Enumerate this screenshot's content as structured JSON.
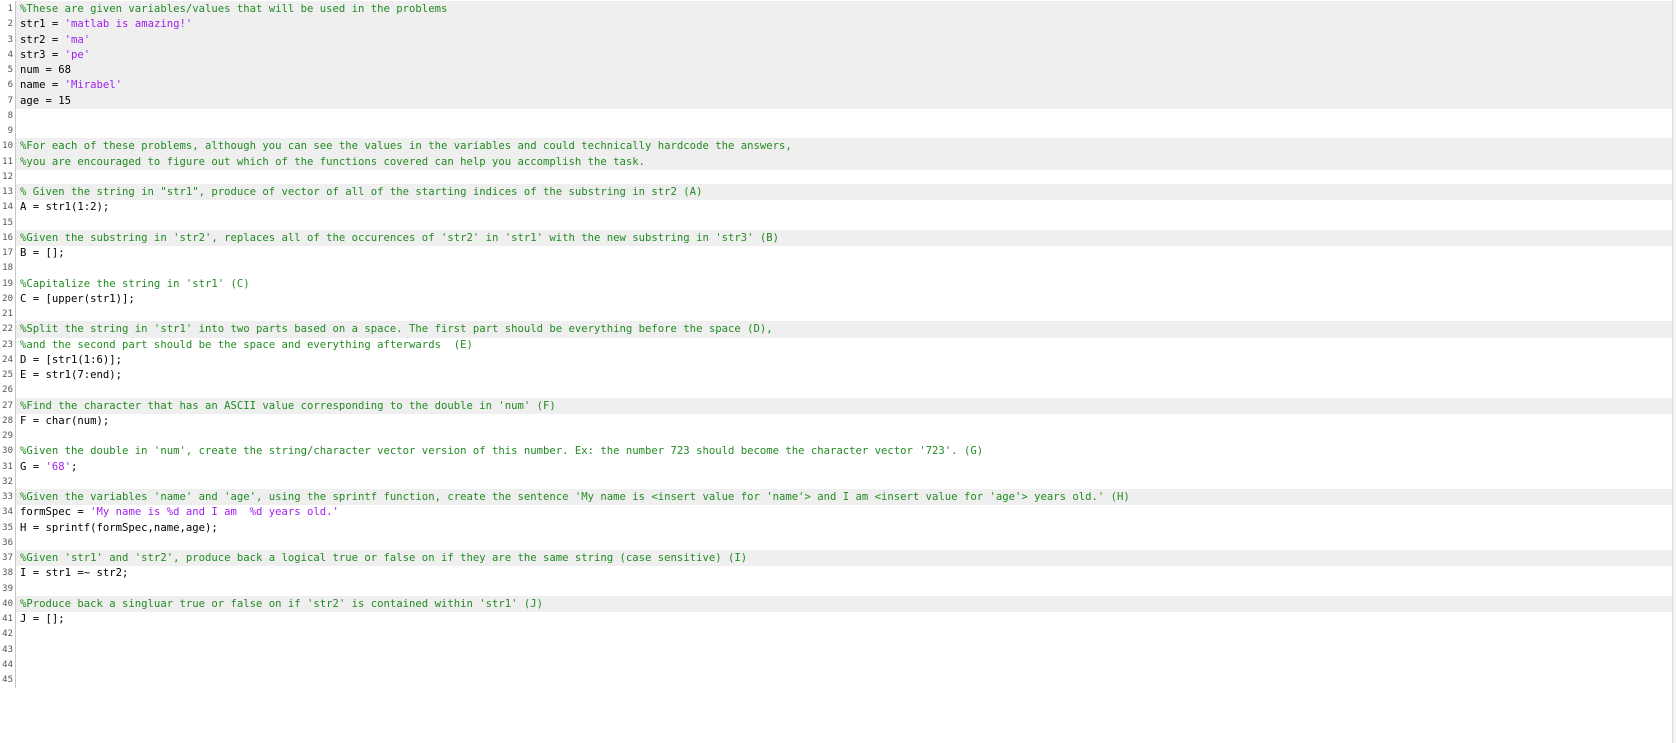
{
  "editor": {
    "lines": [
      {
        "n": "1",
        "cell": true,
        "segs": [
          {
            "t": "c",
            "s": "%These are given variables/values that will be used in the problems"
          }
        ]
      },
      {
        "n": "2",
        "cell": true,
        "segs": [
          {
            "t": "x",
            "s": "str1 = "
          },
          {
            "t": "s",
            "s": "'matlab is amazing!'"
          }
        ]
      },
      {
        "n": "3",
        "cell": true,
        "segs": [
          {
            "t": "x",
            "s": "str2 = "
          },
          {
            "t": "s",
            "s": "'ma'"
          }
        ]
      },
      {
        "n": "4",
        "cell": true,
        "segs": [
          {
            "t": "x",
            "s": "str3 = "
          },
          {
            "t": "s",
            "s": "'pe'"
          }
        ]
      },
      {
        "n": "5",
        "cell": true,
        "segs": [
          {
            "t": "x",
            "s": "num = 68"
          }
        ]
      },
      {
        "n": "6",
        "cell": true,
        "segs": [
          {
            "t": "x",
            "s": "name = "
          },
          {
            "t": "s",
            "s": "'Mirabel'"
          }
        ]
      },
      {
        "n": "7",
        "cell": true,
        "segs": [
          {
            "t": "x",
            "s": "age = 15"
          }
        ]
      },
      {
        "n": "8",
        "cell": false,
        "segs": []
      },
      {
        "n": "9",
        "cell": false,
        "segs": []
      },
      {
        "n": "10",
        "cell": true,
        "segs": [
          {
            "t": "c",
            "s": "%For each of these problems, although you can see the values in the variables and could technically hardcode the answers,"
          }
        ]
      },
      {
        "n": "11",
        "cell": true,
        "segs": [
          {
            "t": "c",
            "s": "%you are encouraged to figure out which of the functions covered can help you accomplish the task."
          }
        ]
      },
      {
        "n": "12",
        "cell": false,
        "segs": []
      },
      {
        "n": "13",
        "cell": true,
        "segs": [
          {
            "t": "c",
            "s": "% Given the string in \"str1\", produce of vector of all of the starting indices of the substring in str2 (A)"
          }
        ]
      },
      {
        "n": "14",
        "cell": false,
        "segs": [
          {
            "t": "x",
            "s": "A = str1(1:2);"
          }
        ]
      },
      {
        "n": "15",
        "cell": false,
        "segs": []
      },
      {
        "n": "16",
        "cell": true,
        "segs": [
          {
            "t": "c",
            "s": "%Given the substring in 'str2', replaces all of the occurences of 'str2' in 'str1' with the new substring in 'str3' (B)"
          }
        ]
      },
      {
        "n": "17",
        "cell": false,
        "segs": [
          {
            "t": "x",
            "s": "B = [];"
          }
        ]
      },
      {
        "n": "18",
        "cell": false,
        "segs": []
      },
      {
        "n": "19",
        "cell": false,
        "segs": [
          {
            "t": "c",
            "s": "%Capitalize the string in 'str1' (C)"
          }
        ]
      },
      {
        "n": "20",
        "cell": false,
        "segs": [
          {
            "t": "x",
            "s": "C = [upper(str1)];"
          }
        ]
      },
      {
        "n": "21",
        "cell": false,
        "segs": []
      },
      {
        "n": "22",
        "cell": true,
        "segs": [
          {
            "t": "c",
            "s": "%Split the string in 'str1' into two parts based on a space. The first part should be everything before the space (D),"
          }
        ]
      },
      {
        "n": "23",
        "cell": false,
        "segs": [
          {
            "t": "c",
            "s": "%and the second part should be the space and everything afterwards  (E)"
          }
        ]
      },
      {
        "n": "24",
        "cell": false,
        "segs": [
          {
            "t": "x",
            "s": "D = [str1(1:6)];"
          }
        ]
      },
      {
        "n": "25",
        "cell": false,
        "segs": [
          {
            "t": "x",
            "s": "E = str1(7:end);"
          }
        ]
      },
      {
        "n": "26",
        "cell": false,
        "segs": []
      },
      {
        "n": "27",
        "cell": true,
        "segs": [
          {
            "t": "c",
            "s": "%Find the character that has an ASCII value corresponding to the double in 'num' (F)"
          }
        ]
      },
      {
        "n": "28",
        "cell": false,
        "segs": [
          {
            "t": "x",
            "s": "F = char(num);"
          }
        ]
      },
      {
        "n": "29",
        "cell": false,
        "segs": []
      },
      {
        "n": "30",
        "cell": false,
        "segs": [
          {
            "t": "c",
            "s": "%Given the double in 'num', create the string/character vector version of this number. Ex: the number 723 should become the character vector '723'. (G)"
          }
        ]
      },
      {
        "n": "31",
        "cell": false,
        "segs": [
          {
            "t": "x",
            "s": "G = "
          },
          {
            "t": "s",
            "s": "'68'"
          },
          {
            "t": "x",
            "s": ";"
          }
        ]
      },
      {
        "n": "32",
        "cell": false,
        "segs": []
      },
      {
        "n": "33",
        "cell": true,
        "segs": [
          {
            "t": "c",
            "s": "%Given the variables 'name' and 'age', using the sprintf function, create the sentence 'My name is <insert value for 'name'> and I am <insert value for 'age'> years old.' (H)"
          }
        ]
      },
      {
        "n": "34",
        "cell": false,
        "segs": [
          {
            "t": "x",
            "s": "formSpec = "
          },
          {
            "t": "s",
            "s": "'My name is %d and I am  %d years old.'"
          }
        ]
      },
      {
        "n": "35",
        "cell": false,
        "segs": [
          {
            "t": "x",
            "s": "H = sprintf(formSpec,name,age);"
          }
        ]
      },
      {
        "n": "36",
        "cell": false,
        "segs": []
      },
      {
        "n": "37",
        "cell": true,
        "segs": [
          {
            "t": "c",
            "s": "%Given 'str1' and 'str2', produce back a logical true or false on if they are the same string (case sensitive) (I)"
          }
        ]
      },
      {
        "n": "38",
        "cell": false,
        "segs": [
          {
            "t": "x",
            "s": "I = str1 =~ str2;"
          }
        ]
      },
      {
        "n": "39",
        "cell": false,
        "segs": []
      },
      {
        "n": "40",
        "cell": true,
        "segs": [
          {
            "t": "c",
            "s": "%Produce back a singluar true or false on if 'str2' is contained within 'str1' (J)"
          }
        ]
      },
      {
        "n": "41",
        "cell": false,
        "segs": [
          {
            "t": "x",
            "s": "J = [];"
          }
        ]
      },
      {
        "n": "42",
        "cell": false,
        "segs": []
      },
      {
        "n": "43",
        "cell": false,
        "segs": []
      },
      {
        "n": "44",
        "cell": false,
        "segs": []
      },
      {
        "n": "45",
        "cell": false,
        "segs": []
      }
    ]
  },
  "colors": {
    "comment": "#228b22",
    "string": "#a020f0",
    "code": "#000000",
    "cell_highlight": "#efefef"
  }
}
